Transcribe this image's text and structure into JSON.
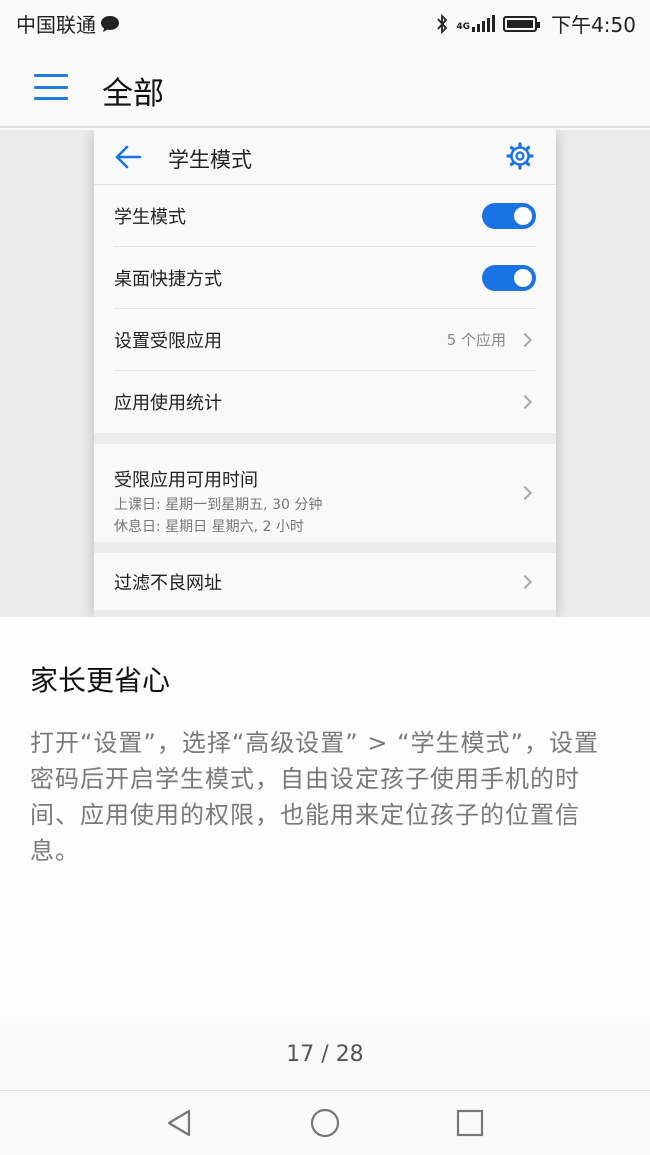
{
  "status_bar": {
    "carrier": "中国联通",
    "network": "4G",
    "time": "下午4:50"
  },
  "header": {
    "title": "全部"
  },
  "preview": {
    "title": "学生模式",
    "rows": [
      {
        "label": "学生模式",
        "type": "toggle",
        "on": true
      },
      {
        "label": "桌面快捷方式",
        "type": "toggle",
        "on": true
      },
      {
        "label": "设置受限应用",
        "value": "5 个应用",
        "type": "link"
      },
      {
        "label": "应用使用统计",
        "type": "link"
      }
    ],
    "limited_time": {
      "title": "受限应用可用时间",
      "line1": "上课日: 星期一到星期五, 30 分钟",
      "line2": "休息日: 星期日 星期六, 2 小时"
    },
    "filter_row": {
      "label": "过滤不良网址"
    }
  },
  "description": {
    "title": "家长更省心",
    "body": "打开“设置”，选择“高级设置” > “学生模式”，设置密码后开启学生模式，自由设定孩子使用手机的时间、应用使用的权限，也能用来定位孩子的位置信息。"
  },
  "pager": {
    "text": "17 / 28",
    "current": 17,
    "total": 28
  },
  "colors": {
    "accent": "#1a72e4",
    "hamburger": "#1e7ee6"
  },
  "icons": {
    "menu": "hamburger-menu-icon",
    "back": "back-arrow-icon",
    "settings": "gear-icon",
    "chevron": "chevron-right-icon",
    "nav_back": "triangle-back-icon",
    "nav_home": "circle-home-icon",
    "nav_recent": "square-recent-icon"
  }
}
